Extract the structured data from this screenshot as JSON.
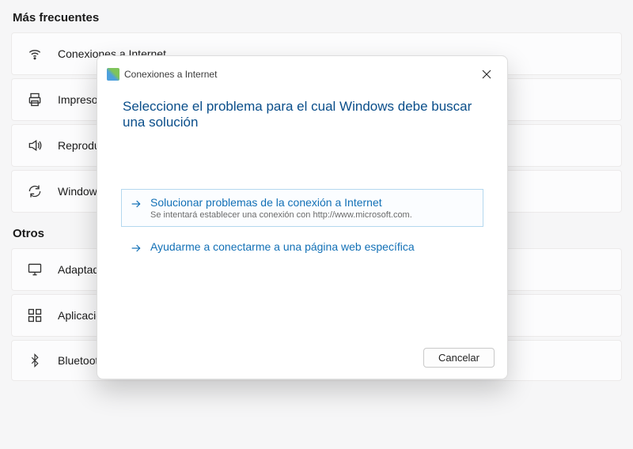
{
  "sections": {
    "frequent": {
      "title": "Más frecuentes",
      "items": [
        {
          "label": "Conexiones a Internet",
          "icon": "wifi"
        },
        {
          "label": "Impresora",
          "icon": "printer"
        },
        {
          "label": "Reproducir",
          "icon": "sound"
        },
        {
          "label": "Windows",
          "icon": "refresh"
        }
      ]
    },
    "others": {
      "title": "Otros",
      "items": [
        {
          "label": "Adaptador",
          "icon": "monitor"
        },
        {
          "label": "Aplicaciones",
          "icon": "apps"
        },
        {
          "label": "Bluetooth",
          "icon": "bluetooth"
        }
      ]
    }
  },
  "dialog": {
    "title": "Conexiones a Internet",
    "heading": "Seleccione el problema para el cual Windows debe buscar una solución",
    "options": [
      {
        "title": "Solucionar problemas de la conexión a Internet",
        "sub": "Se intentará establecer una conexión con http://www.microsoft.com."
      },
      {
        "title": "Ayudarme a conectarme a una página web específica",
        "sub": ""
      }
    ],
    "cancel": "Cancelar"
  }
}
